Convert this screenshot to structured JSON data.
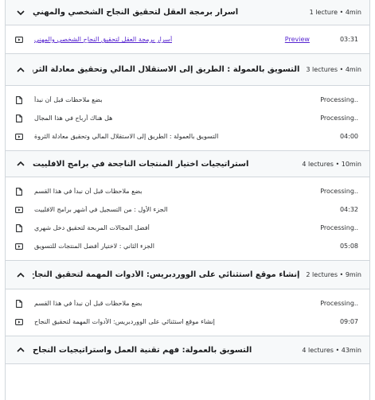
{
  "sections": [
    {
      "title": "أسرار برمجة العقل لتحقيق النجاح الشخصي والمهني",
      "meta": "1 lecture • 4min",
      "expanded": true,
      "chevron": "chevron-down-icon",
      "lectures": [
        {
          "title": "أسرار برمجة العقل لتحقيق النجاح الشخصي والمهني",
          "icon": "video-icon",
          "preview": "Preview",
          "status": "03:31",
          "link": true
        }
      ]
    },
    {
      "title": "التسويق بالعمولة : الطريق إلى الاستقلال المالي وتحقيق معادلة الثروة",
      "meta": "3 lectures • 4min",
      "expanded": true,
      "chevron": "chevron-up-icon",
      "lectures": [
        {
          "title": "بضع ملاحظات قبل أن نبدأ",
          "icon": "document-icon",
          "status": "Processing.."
        },
        {
          "title": "هل هناك أرباح في هذا المجال",
          "icon": "document-icon",
          "status": "Processing.."
        },
        {
          "title": "التسويق بالعمولة : الطريق إلى الاستقلال المالي وتحقيق معادلة الثروة",
          "icon": "video-icon",
          "status": "04:00"
        }
      ]
    },
    {
      "title": "استراتيجيات اختيار المنتجات الناجحة في برامج الافلييت",
      "meta": "4 lectures • 10min",
      "expanded": true,
      "chevron": "chevron-up-icon",
      "lectures": [
        {
          "title": "بضع ملاحظات قبل أن نبدأ في هذا القسم",
          "icon": "document-icon",
          "status": "Processing.."
        },
        {
          "title": "الجزء الأول : من التسجيل في أشهر برامج الافلييت",
          "icon": "video-icon",
          "status": "04:32"
        },
        {
          "title": "أفضل المجالات المربحة لتحقيق دخل شهري",
          "icon": "document-icon",
          "status": "Processing.."
        },
        {
          "title": "الجزء الثاني : لاختيار أفضل المنتجات للتسويق",
          "icon": "video-icon",
          "status": "05:08"
        }
      ]
    },
    {
      "title": "إنشاء موقع استثنائي على الووردبريس: الأدوات المهمة لتحقيق النجاح",
      "meta": "2 lectures • 9min",
      "expanded": true,
      "chevron": "chevron-up-icon",
      "lectures": [
        {
          "title": "بضع ملاحظات قبل أن نبدأ في هذا القسم",
          "icon": "document-icon",
          "status": "Processing.."
        },
        {
          "title": "إنشاء موقع استثنائي على الووردبريس: الأدوات المهمة لتحقيق النجاح",
          "icon": "video-icon",
          "status": "09:07"
        }
      ]
    },
    {
      "title": "التسويق بالعمولة: فهم تقنية العمل واستراتيجيات النجاح",
      "meta": "4 lectures • 43min",
      "expanded": false,
      "chevron": "chevron-up-icon",
      "lectures": []
    }
  ]
}
